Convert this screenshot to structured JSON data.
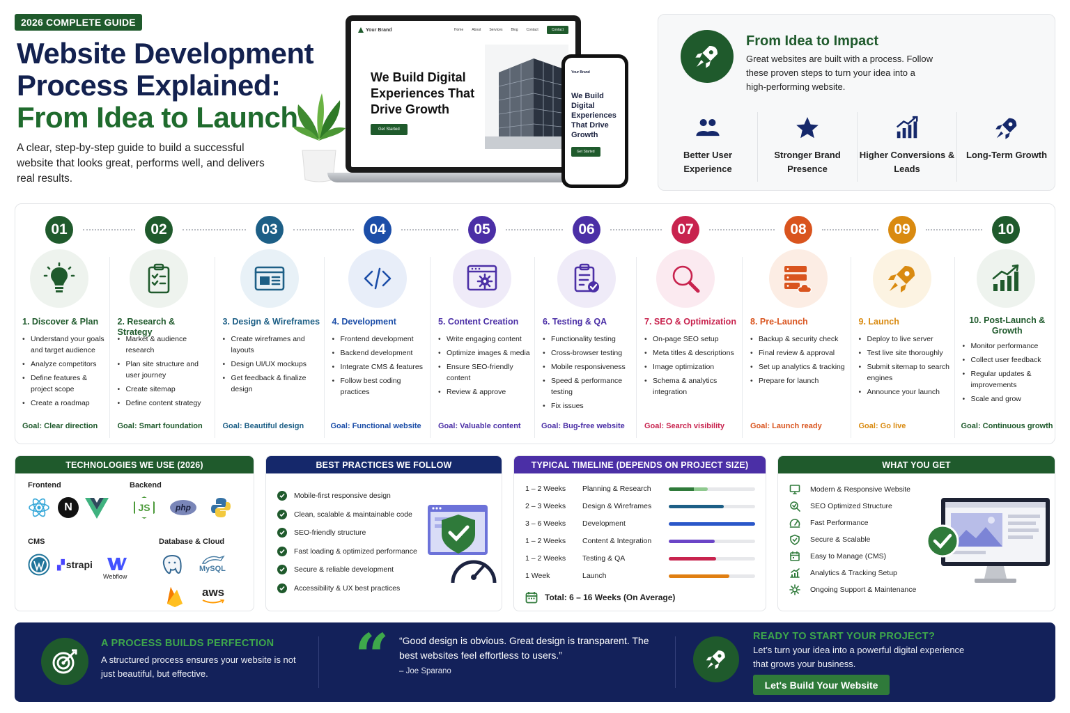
{
  "hero": {
    "badge": "2026 COMPLETE GUIDE",
    "title_line1": "Website Development",
    "title_line2": "Process Explained:",
    "title_line3": "From Idea to Launch",
    "subtitle": "A clear, step-by-step guide to build a successful website that looks great, performs well, and delivers real results."
  },
  "mockup": {
    "brand": "Your Brand",
    "nav": [
      "Home",
      "About",
      "Services",
      "Blog",
      "Contact"
    ],
    "contact_btn": "Contact",
    "headline": "We Build Digital Experiences That Drive Growth",
    "cta": "Get Started"
  },
  "impact": {
    "title": "From Idea to Impact",
    "text": "Great websites are built with a process. Follow these proven steps to turn your idea into a high-performing website.",
    "benefits": [
      {
        "label": "Better User Experience",
        "icon": "users-icon"
      },
      {
        "label": "Stronger Brand Presence",
        "icon": "star-icon"
      },
      {
        "label": "Higher Conversions & Leads",
        "icon": "bar-chart-icon"
      },
      {
        "label": "Long-Term Growth",
        "icon": "rocket-icon"
      }
    ]
  },
  "steps": [
    {
      "num": "01",
      "title": "1. Discover & Plan",
      "color": "#1f5a2c",
      "bg": "#eef3ee",
      "icon": "lightbulb-icon",
      "items": [
        "Understand your goals and target audience",
        "Analyze competitors",
        "Define features & project scope",
        "Create a roadmap"
      ],
      "goal": "Goal: Clear direction"
    },
    {
      "num": "02",
      "title": "2. Research & Strategy",
      "color": "#1f5a2c",
      "bg": "#eef3ee",
      "icon": "clipboard-icon",
      "items": [
        "Market & audience research",
        "Plan site structure and user journey",
        "Create sitemap",
        "Define content strategy"
      ],
      "goal": "Goal: Smart foundation"
    },
    {
      "num": "03",
      "title": "3. Design & Wireframes",
      "color": "#1d5f86",
      "bg": "#e8f1f7",
      "icon": "wireframe-icon",
      "items": [
        "Create wireframes and layouts",
        "Design UI/UX mockups",
        "Get feedback & finalize design"
      ],
      "goal": "Goal: Beautiful design"
    },
    {
      "num": "04",
      "title": "4. Development",
      "color": "#1c4ea8",
      "bg": "#e8eef9",
      "icon": "code-icon",
      "items": [
        "Frontend development",
        "Backend development",
        "Integrate CMS & features",
        "Follow best coding practices"
      ],
      "goal": "Goal: Functional website"
    },
    {
      "num": "05",
      "title": "5. Content Creation",
      "color": "#4b2fa6",
      "bg": "#efebf8",
      "icon": "browser-gear-icon",
      "items": [
        "Write engaging content",
        "Optimize images & media",
        "Ensure SEO-friendly content",
        "Review & approve"
      ],
      "goal": "Goal: Valuable content"
    },
    {
      "num": "06",
      "title": "6. Testing & QA",
      "color": "#4b2fa6",
      "bg": "#efebf8",
      "icon": "checklist-icon",
      "items": [
        "Functionality testing",
        "Cross-browser testing",
        "Mobile responsiveness",
        "Speed & performance testing",
        "Fix issues"
      ],
      "goal": "Goal: Bug-free website"
    },
    {
      "num": "07",
      "title": "7. SEO & Optimization",
      "color": "#c8234e",
      "bg": "#fbeaf0",
      "icon": "magnifier-icon",
      "items": [
        "On-page SEO setup",
        "Meta titles & descriptions",
        "Image optimization",
        "Schema & analytics integration"
      ],
      "goal": "Goal: Search visibility"
    },
    {
      "num": "08",
      "title": "8. Pre-Launch",
      "color": "#d9541e",
      "bg": "#fcede4",
      "icon": "server-cloud-icon",
      "items": [
        "Backup & security check",
        "Final review & approval",
        "Set up analytics & tracking",
        "Prepare for launch"
      ],
      "goal": "Goal: Launch ready"
    },
    {
      "num": "09",
      "title": "9. Launch",
      "color": "#d98a10",
      "bg": "#fcf3e2",
      "icon": "rocket-icon",
      "items": [
        "Deploy to live server",
        "Test live site thoroughly",
        "Submit sitemap to search engines",
        "Announce your launch"
      ],
      "goal": "Goal: Go live"
    },
    {
      "num": "10",
      "title": "10. Post-Launch & Growth",
      "color": "#1f5a2c",
      "bg": "#eef3ee",
      "icon": "growth-chart-icon",
      "items": [
        "Monitor performance",
        "Collect user feedback",
        "Regular updates & improvements",
        "Scale and grow"
      ],
      "goal": "Goal: Continuous growth"
    }
  ],
  "tech": {
    "heading": "TECHNOLOGIES WE USE (2026)",
    "frontend_label": "Frontend",
    "backend_label": "Backend",
    "cms_label": "CMS",
    "db_label": "Database & Cloud",
    "logos": {
      "react": "react-icon",
      "next": "N",
      "vue": "vue-icon",
      "node": "JS",
      "php": "php",
      "python": "python-icon",
      "wordpress": "wordpress-icon",
      "strapi": "strapi",
      "webflow": "Webflow",
      "postgres": "postgres-icon",
      "mysql": "MySQL",
      "firebase": "firebase-icon",
      "aws": "aws"
    }
  },
  "best_practices": {
    "heading": "BEST PRACTICES WE FOLLOW",
    "items": [
      "Mobile-first responsive design",
      "Clean, scalable & maintainable code",
      "SEO-friendly structure",
      "Fast loading & optimized performance",
      "Secure & reliable development",
      "Accessibility & UX best practices"
    ]
  },
  "timeline": {
    "heading": "TYPICAL TIMELINE (DEPENDS ON PROJECT SIZE)",
    "rows": [
      {
        "duration": "1 – 2 Weeks",
        "phase": "Planning & Research",
        "progress": 0.45,
        "color": "#2f7a3a",
        "color2": "#8fc98f"
      },
      {
        "duration": "2 – 3 Weeks",
        "phase": "Design & Wireframes",
        "progress": 0.64,
        "color": "#1d5f86"
      },
      {
        "duration": "3 – 6 Weeks",
        "phase": "Development",
        "progress": 1.0,
        "color": "#2a57c9"
      },
      {
        "duration": "1 – 2 Weeks",
        "phase": "Content & Integration",
        "progress": 0.53,
        "color": "#6b45c7"
      },
      {
        "duration": "1 – 2 Weeks",
        "phase": "Testing & QA",
        "progress": 0.55,
        "color": "#c8234e"
      },
      {
        "duration": "1 Week",
        "phase": "Launch",
        "progress": 0.7,
        "color": "#e07f12"
      }
    ],
    "total": "Total: 6 – 16 Weeks (On Average)"
  },
  "what_you_get": {
    "heading": "WHAT YOU GET",
    "items": [
      {
        "label": "Modern & Responsive Website",
        "icon": "monitor-icon"
      },
      {
        "label": "SEO Optimized Structure",
        "icon": "search-icon"
      },
      {
        "label": "Fast Performance",
        "icon": "speedometer-icon"
      },
      {
        "label": "Secure & Scalable",
        "icon": "shield-icon"
      },
      {
        "label": "Easy to Manage (CMS)",
        "icon": "calendar-icon"
      },
      {
        "label": "Analytics & Tracking Setup",
        "icon": "analytics-icon"
      },
      {
        "label": "Ongoing Support & Maintenance",
        "icon": "gear-icon"
      }
    ]
  },
  "footer": {
    "left_title": "A PROCESS BUILDS PERFECTION",
    "left_text": "A structured process ensures your website is not just beautiful, but effective.",
    "quote": "“Good design is obvious. Great design is transparent. The best websites feel effortless to users.”",
    "quote_author": "– Joe Sparano",
    "right_title": "READY TO START YOUR PROJECT?",
    "right_text": "Let’s turn your idea into a powerful digital experience that grows your business.",
    "cta": "Let's Build Your Website"
  }
}
